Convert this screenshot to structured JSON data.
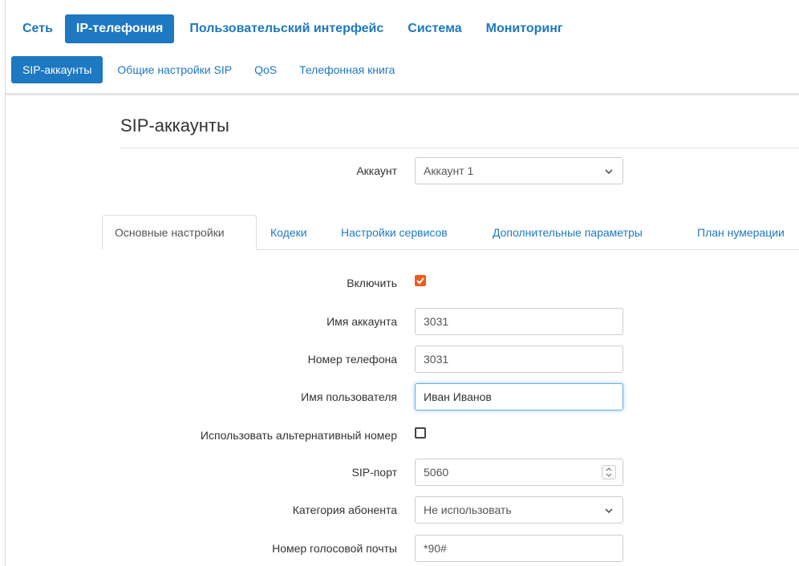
{
  "main_nav": {
    "items": [
      {
        "label": "Сеть"
      },
      {
        "label": "IP-телефония",
        "active": true
      },
      {
        "label": "Пользовательский интерфейс"
      },
      {
        "label": "Система"
      },
      {
        "label": "Мониторинг"
      }
    ]
  },
  "sub_nav": {
    "items": [
      {
        "label": "SIP-аккаунты",
        "active": true
      },
      {
        "label": "Общие настройки SIP"
      },
      {
        "label": "QoS"
      },
      {
        "label": "Телефонная книга"
      }
    ]
  },
  "page": {
    "title": "SIP-аккаунты"
  },
  "account_select": {
    "label": "Аккаунт",
    "value": "Аккаунт 1"
  },
  "tabs": [
    {
      "label": "Основные настройки",
      "active": true
    },
    {
      "label": "Кодеки"
    },
    {
      "label": "Настройки сервисов"
    },
    {
      "label": "Дополнительные параметры"
    },
    {
      "label": "План нумерации"
    }
  ],
  "form": {
    "enable": {
      "label": "Включить",
      "checked": true
    },
    "account_name": {
      "label": "Имя аккаунта",
      "value": "3031"
    },
    "phone_number": {
      "label": "Номер телефона",
      "value": "3031"
    },
    "username": {
      "label": "Имя пользователя",
      "value": "Иван Иванов"
    },
    "alt_number": {
      "label": "Использовать альтернативный номер",
      "checked": false
    },
    "sip_port": {
      "label": "SIP-порт",
      "value": "5060"
    },
    "subscriber_category": {
      "label": "Категория абонента",
      "value": "Не использовать"
    },
    "voicemail_number": {
      "label": "Номер голосовой почты",
      "value": "*90#"
    }
  },
  "colors": {
    "accent": "#1e78c2",
    "checkbox_checked": "#f05a1e",
    "focus": "#66afe9"
  }
}
